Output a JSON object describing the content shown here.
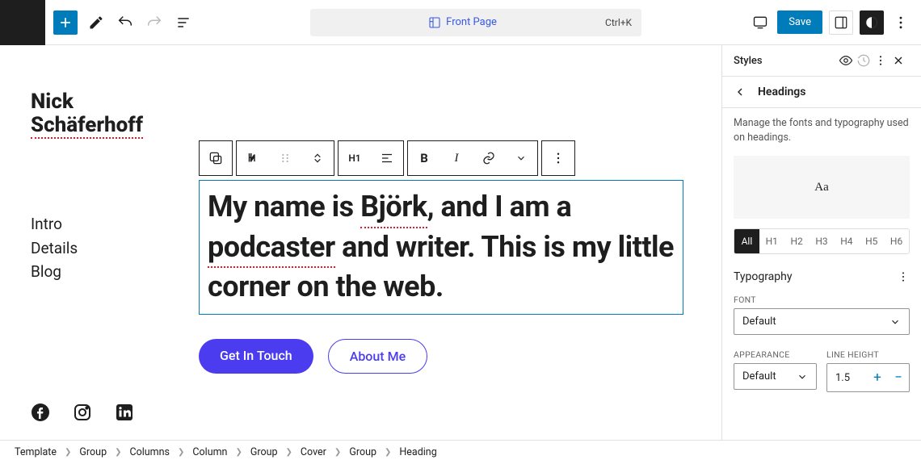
{
  "topbar": {
    "page_label": "Front Page",
    "shortcut": "Ctrl+K",
    "save_label": "Save"
  },
  "site": {
    "title_first": "Nick",
    "title_last": "Schäferhoff",
    "nav": [
      "Intro",
      "Details",
      "Blog"
    ]
  },
  "hero": {
    "text_a": "My name is ",
    "text_b": "Björk",
    "text_c": ", and I am a ",
    "text_d": "podcaster",
    "text_e": " and writer. This is my little corner on the web.",
    "cta_primary": "Get In Touch",
    "cta_secondary": "About Me",
    "toolbar_level": "H1"
  },
  "panel": {
    "title": "Styles",
    "sub": "Headings",
    "desc": "Manage the fonts and typography used on headings.",
    "preview": "Aa",
    "levels": [
      "All",
      "H1",
      "H2",
      "H3",
      "H4",
      "H5",
      "H6"
    ],
    "active_level": "All",
    "typography_label": "Typography",
    "font_label": "FONT",
    "font_value": "Default",
    "appearance_label": "APPEARANCE",
    "appearance_value": "Default",
    "lineheight_label": "LINE HEIGHT",
    "lineheight_value": "1.5"
  },
  "breadcrumbs": [
    "Template",
    "Group",
    "Columns",
    "Column",
    "Group",
    "Cover",
    "Group",
    "Heading"
  ]
}
